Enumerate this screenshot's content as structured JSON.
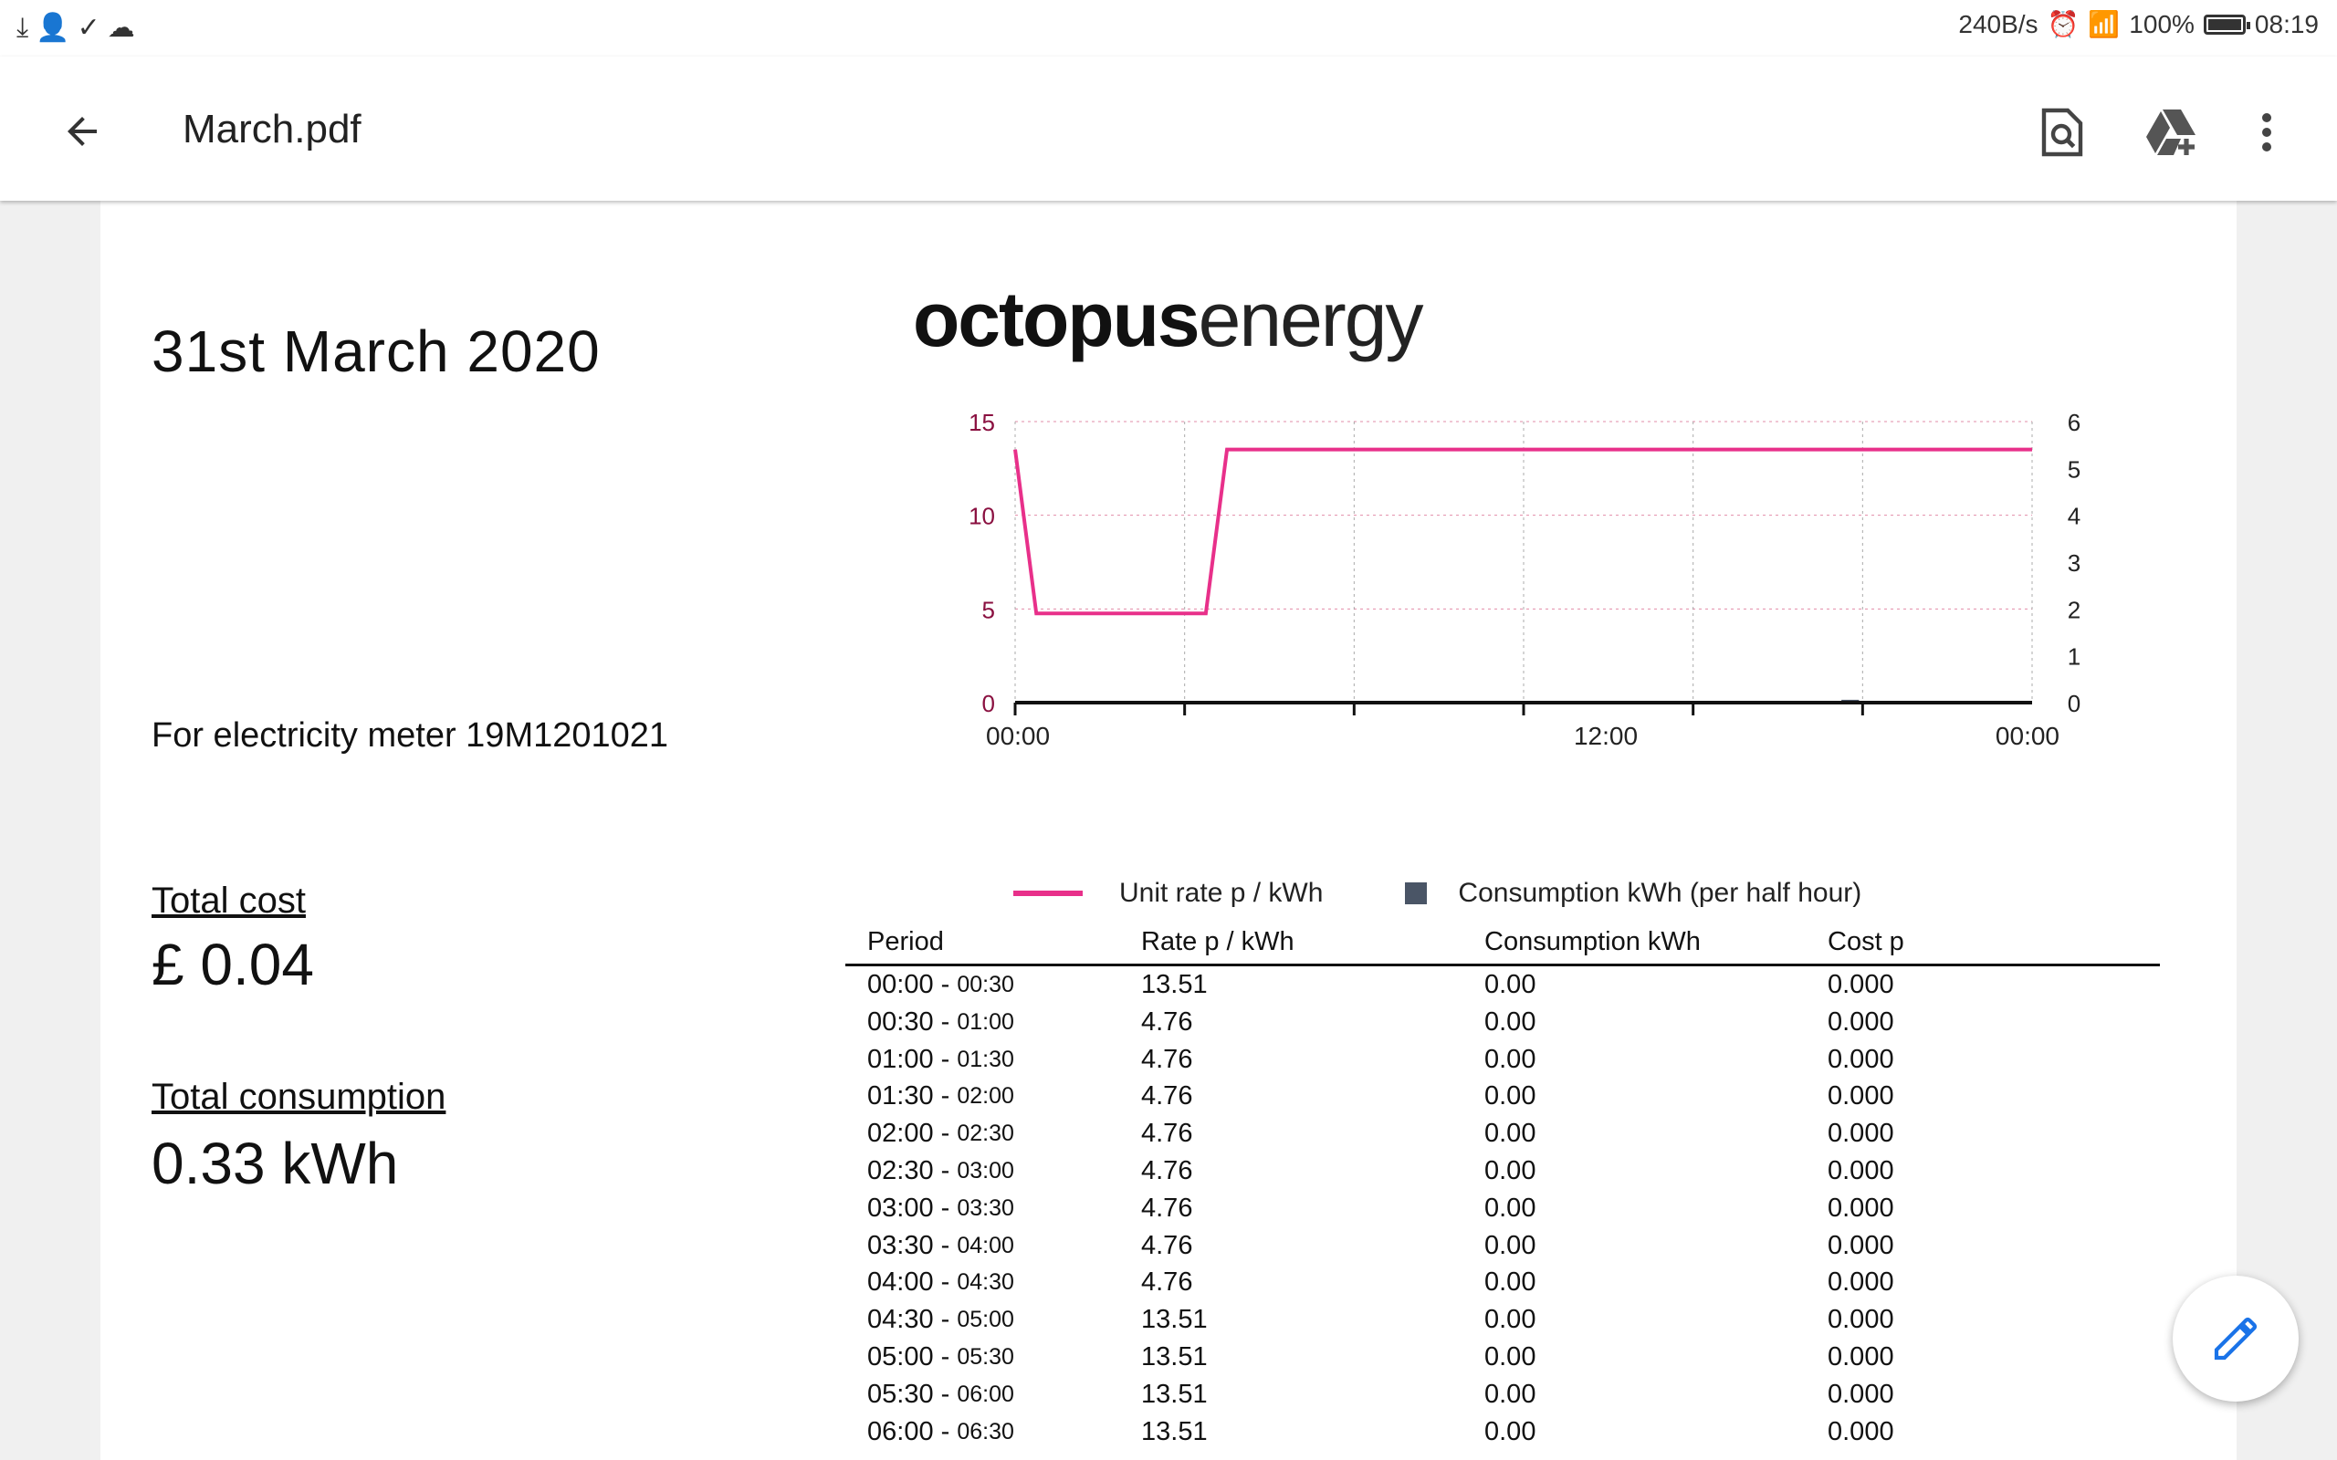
{
  "status_bar": {
    "left_icons": [
      "download-icon",
      "person-add-icon",
      "check-icon",
      "cloud-icon"
    ],
    "net_speed": "240B/s",
    "battery": "100%",
    "time": "08:19"
  },
  "app_bar": {
    "title": "March.pdf",
    "actions": [
      "find-in-document-icon",
      "add-to-drive-icon",
      "more-options-icon"
    ]
  },
  "document": {
    "date": "31st March 2020",
    "meter": "For electricity meter 19M1201021",
    "total_cost_label": "Total cost",
    "total_cost_value": "£ 0.04",
    "total_consumption_label": "Total consumption",
    "total_consumption_value": "0.33 kWh",
    "logo_bold": "octopus",
    "logo_light": "energy",
    "legend": {
      "rate": "Unit rate p / kWh",
      "consumption": "Consumption kWh (per half hour)"
    },
    "table": {
      "headers": [
        "Period",
        "Rate p / kWh",
        "Consumption kWh",
        "Cost p"
      ],
      "rows": [
        {
          "start": "00:00",
          "end": "00:30",
          "rate": "13.51",
          "consumption": "0.00",
          "cost": "0.000"
        },
        {
          "start": "00:30",
          "end": "01:00",
          "rate": "4.76",
          "consumption": "0.00",
          "cost": "0.000"
        },
        {
          "start": "01:00",
          "end": "01:30",
          "rate": "4.76",
          "consumption": "0.00",
          "cost": "0.000"
        },
        {
          "start": "01:30",
          "end": "02:00",
          "rate": "4.76",
          "consumption": "0.00",
          "cost": "0.000"
        },
        {
          "start": "02:00",
          "end": "02:30",
          "rate": "4.76",
          "consumption": "0.00",
          "cost": "0.000"
        },
        {
          "start": "02:30",
          "end": "03:00",
          "rate": "4.76",
          "consumption": "0.00",
          "cost": "0.000"
        },
        {
          "start": "03:00",
          "end": "03:30",
          "rate": "4.76",
          "consumption": "0.00",
          "cost": "0.000"
        },
        {
          "start": "03:30",
          "end": "04:00",
          "rate": "4.76",
          "consumption": "0.00",
          "cost": "0.000"
        },
        {
          "start": "04:00",
          "end": "04:30",
          "rate": "4.76",
          "consumption": "0.00",
          "cost": "0.000"
        },
        {
          "start": "04:30",
          "end": "05:00",
          "rate": "13.51",
          "consumption": "0.00",
          "cost": "0.000"
        },
        {
          "start": "05:00",
          "end": "05:30",
          "rate": "13.51",
          "consumption": "0.00",
          "cost": "0.000"
        },
        {
          "start": "05:30",
          "end": "06:00",
          "rate": "13.51",
          "consumption": "0.00",
          "cost": "0.000"
        },
        {
          "start": "06:00",
          "end": "06:30",
          "rate": "13.51",
          "consumption": "0.00",
          "cost": "0.000"
        }
      ]
    }
  },
  "fab": {
    "icon": "edit-pencil-icon"
  },
  "colors": {
    "rate_line": "#e8308a",
    "consumption_bar": "#4a5566",
    "grid": "#d04070",
    "fab_icon": "#1a73e8"
  },
  "chart_data": {
    "type": "line",
    "x_ticks": [
      "00:00",
      "12:00",
      "00:00"
    ],
    "y_left_ticks": [
      0,
      5,
      10,
      15
    ],
    "y_right_ticks": [
      0,
      1,
      2,
      3,
      4,
      5,
      6
    ],
    "ylim_left": [
      0,
      15
    ],
    "ylim_right": [
      0,
      6
    ],
    "x_range_hours": [
      0,
      24
    ],
    "grid": true,
    "series": [
      {
        "name": "Unit rate p / kWh",
        "axis": "left",
        "x_hours": [
          0,
          0.5,
          4.5,
          5.0,
          24
        ],
        "values": [
          13.51,
          4.76,
          4.76,
          13.51,
          13.51
        ]
      },
      {
        "name": "Consumption kWh (per half hour)",
        "axis": "right",
        "type": "bar",
        "x_hours": [
          8.5,
          9,
          15.5,
          16,
          16.5,
          17,
          19,
          19.5,
          20,
          20.5
        ],
        "values": [
          0.02,
          0.02,
          0.01,
          0.01,
          0.02,
          0.03,
          0.02,
          0.06,
          0.03,
          0.02
        ]
      }
    ]
  }
}
